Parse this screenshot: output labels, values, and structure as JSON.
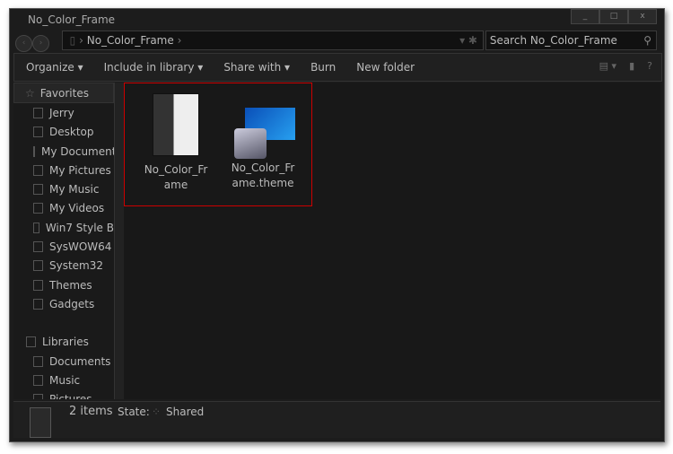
{
  "window": {
    "title": "No_Color_Frame",
    "controls": [
      "_",
      "□",
      "x"
    ]
  },
  "address": {
    "path": "No_Color_Frame",
    "search_placeholder": "Search No_Color_Frame"
  },
  "toolbar": {
    "organize": "Organize ▾",
    "include": "Include in library ▾",
    "share": "Share with ▾",
    "burn": "Burn",
    "new_folder": "New folder"
  },
  "sidebar": {
    "favorites": "Favorites",
    "items": [
      "Jerry",
      "Desktop",
      "My Documents",
      "My Pictures",
      "My Music",
      "My Videos",
      "Win7 Style B",
      "SysWOW64",
      "System32",
      "Themes",
      "Gadgets"
    ],
    "libraries": "Libraries",
    "lib_items": [
      "Documents",
      "Music",
      "Pictures"
    ]
  },
  "files": [
    {
      "name": "No_Color_Frame",
      "icon": "folder-icon"
    },
    {
      "name": "No_Color_Frame.theme",
      "icon": "theme-icon"
    }
  ],
  "status": {
    "count": "2 items",
    "state_label": "State:",
    "state": "Shared"
  },
  "colors": {
    "selection": "#cc0000",
    "background": "#1c1c1c"
  }
}
